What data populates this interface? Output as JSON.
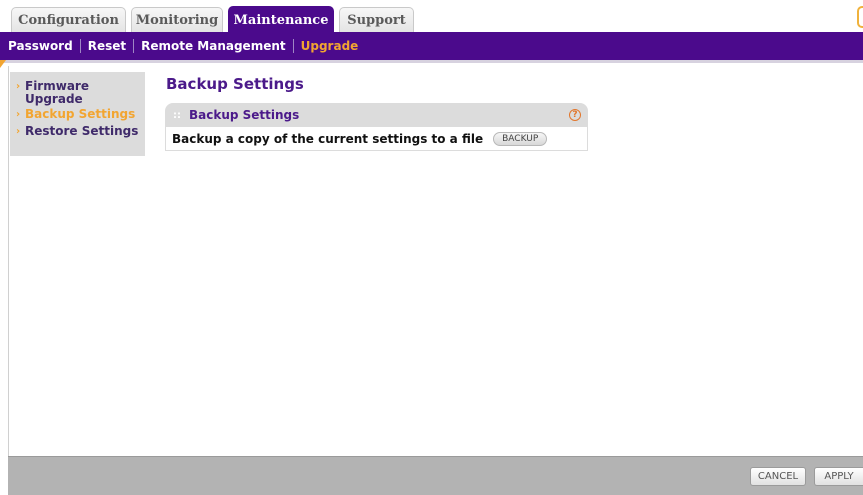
{
  "tabs": [
    {
      "label": "Configuration",
      "active": false
    },
    {
      "label": "Monitoring",
      "active": false
    },
    {
      "label": "Maintenance",
      "active": true
    },
    {
      "label": "Support",
      "active": false
    }
  ],
  "submenu": [
    {
      "label": "Password",
      "active": false
    },
    {
      "label": "Reset",
      "active": false
    },
    {
      "label": "Remote Management",
      "active": false
    },
    {
      "label": "Upgrade",
      "active": true
    }
  ],
  "sidebar": {
    "items": [
      {
        "label": "Firmware Upgrade",
        "active": false
      },
      {
        "label": "Backup Settings",
        "active": true
      },
      {
        "label": "Restore Settings",
        "active": false
      }
    ]
  },
  "page": {
    "title": "Backup Settings",
    "panel_title": "Backup Settings",
    "help_icon": "?",
    "row_label": "Backup a copy of the current settings to a file",
    "backup_button": "BACKUP"
  },
  "footer": {
    "cancel_button": "CANCEL",
    "apply_button": "APPLY"
  },
  "colors": {
    "brand_purple": "#4b0a8c",
    "accent_orange": "#f2a531"
  }
}
